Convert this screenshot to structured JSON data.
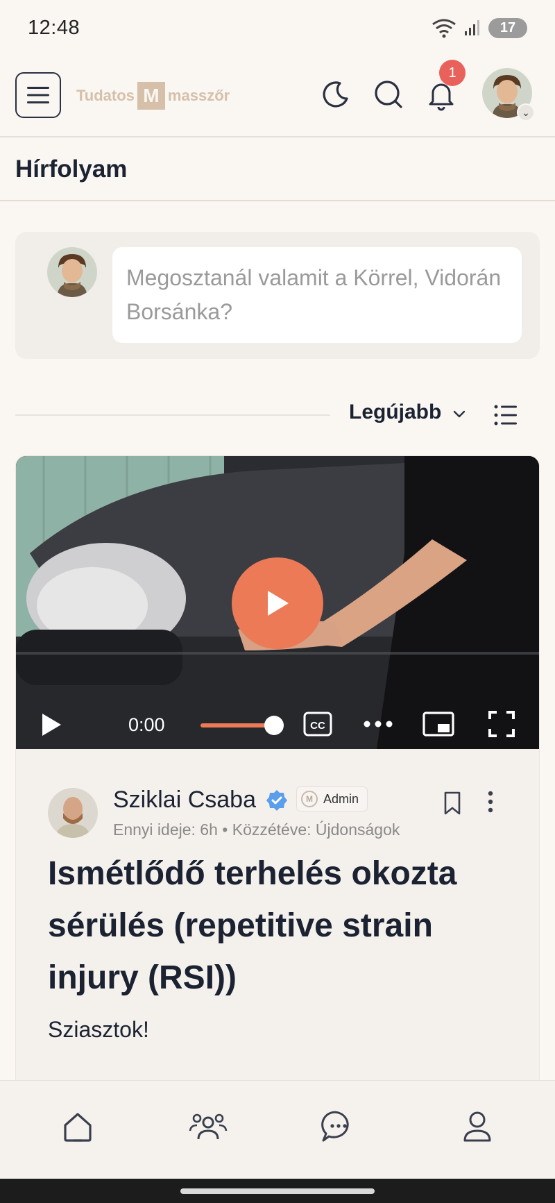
{
  "status_bar": {
    "time": "12:48",
    "battery": "17"
  },
  "header": {
    "logo_left": "Tudatos",
    "logo_mark": "M",
    "logo_right": "masszőr",
    "notification_count": "1"
  },
  "page_title": "Hírfolyam",
  "composer": {
    "placeholder": "Megosztanál valamit a Körrel, Vidorán Borsánka?"
  },
  "sort": {
    "label": "Legújabb"
  },
  "video": {
    "time": "0:00",
    "progress": 0.0
  },
  "post": {
    "author": "Sziklai Csaba",
    "badge": "Admin",
    "meta_age": "Ennyi ideje: 6h",
    "meta_separator": "•",
    "meta_posted_in": "Közzétéve: Újdonságok",
    "title": "Ismétlődő terhelés okozta sérülés (repetitive strain injury (RSI))",
    "greeting": "Sziasztok!"
  },
  "colors": {
    "accent": "#ec7a57",
    "badge": "#e9615b",
    "text": "#1b2232",
    "background": "#faf6f2"
  },
  "icons": {
    "menu": "hamburger-icon",
    "theme": "moon-icon",
    "search": "search-icon",
    "notifications": "bell-icon",
    "list": "list-view-icon",
    "nav": [
      "home-icon",
      "members-icon",
      "messages-icon",
      "profile-icon"
    ]
  }
}
